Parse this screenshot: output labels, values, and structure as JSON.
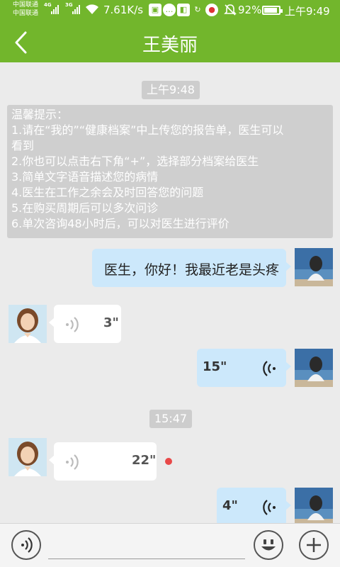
{
  "status_bar": {
    "carrier_line1": "中国联通",
    "carrier_line2": "中国联通",
    "net_1": "4G",
    "net_2": "3G",
    "speed": "7.61K/s",
    "battery": "92%",
    "time": "上午9:49"
  },
  "header": {
    "title": "王美丽"
  },
  "chat": {
    "time_1": "上午9:48",
    "time_2": "15:47",
    "notice_lines": [
      "温馨提示：",
      "1.请在“我的”“健康档案”中上传您的报告单，医生可以",
      "看到",
      "2.你也可以点击右下角“+”，选择部分档案给医生",
      "3.简单文字语音描述您的病情",
      "4.医生在工作之余会及时回答您的问题",
      "5.在购买周期后可以多次问诊",
      "6.单次咨询48小时后，可以对医生进行评价"
    ],
    "messages": [
      {
        "text": "医生，你好！我最近老是头疼"
      },
      {
        "duration": "3\""
      },
      {
        "duration": "15\""
      },
      {
        "duration": "22\"",
        "unread": true
      },
      {
        "duration": "4\""
      }
    ]
  },
  "input_bar": {
    "placeholder": ""
  },
  "colors": {
    "primary": "#72b62c",
    "bubble_out": "#cce8fb",
    "bubble_in": "#ffffff",
    "unread": "#e84848"
  },
  "icons": [
    "back-arrow-icon",
    "voice-icon",
    "emoji-icon",
    "plus-icon",
    "wifi-icon",
    "bell-mute-icon",
    "battery-icon"
  ]
}
